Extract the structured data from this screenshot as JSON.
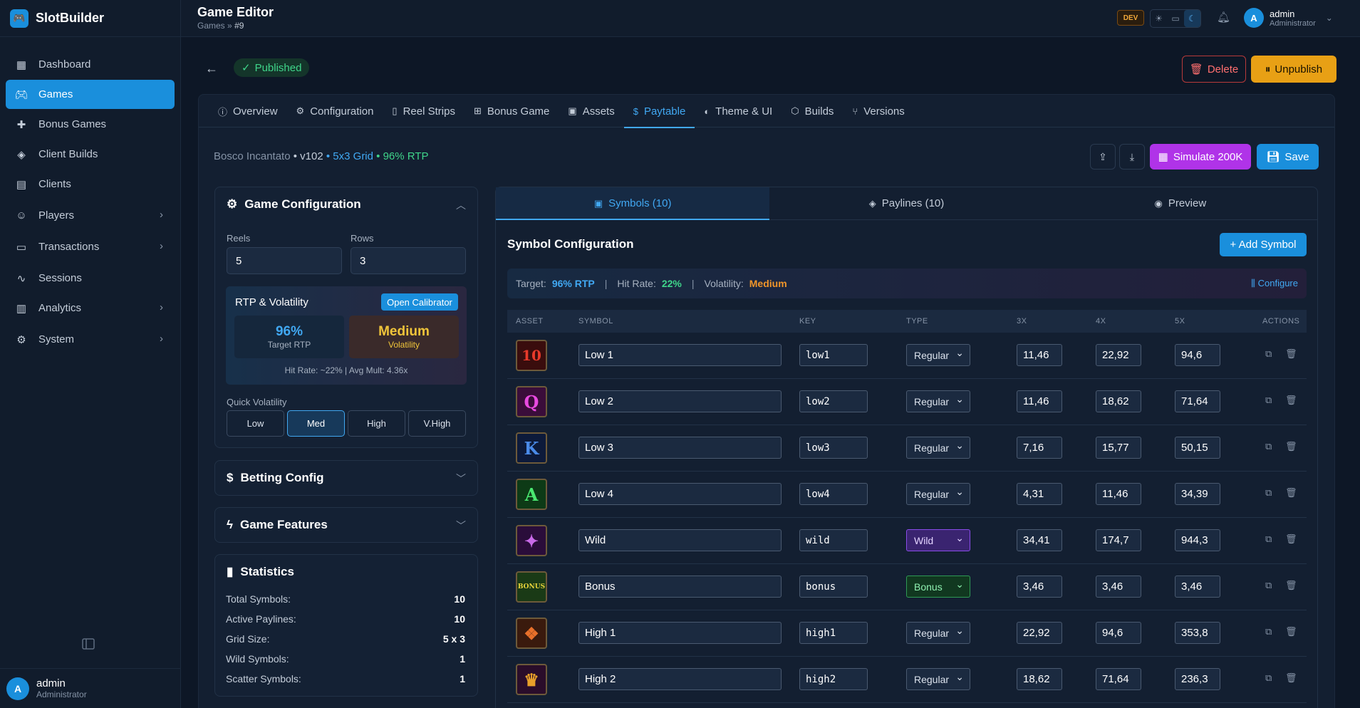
{
  "brand": {
    "name": "SlotBuilder"
  },
  "sidebar": {
    "items": [
      {
        "label": "Dashboard",
        "icon": "dashboard-icon",
        "active": false,
        "chevron": false
      },
      {
        "label": "Games",
        "icon": "gamepad-icon",
        "active": true,
        "chevron": false
      },
      {
        "label": "Bonus Games",
        "icon": "puzzle-icon",
        "active": false,
        "chevron": false
      },
      {
        "label": "Client Builds",
        "icon": "layers-icon",
        "active": false,
        "chevron": false
      },
      {
        "label": "Clients",
        "icon": "building-icon",
        "active": false,
        "chevron": false
      },
      {
        "label": "Players",
        "icon": "users-icon",
        "active": false,
        "chevron": true
      },
      {
        "label": "Transactions",
        "icon": "receipt-icon",
        "active": false,
        "chevron": true
      },
      {
        "label": "Sessions",
        "icon": "activity-icon",
        "active": false,
        "chevron": false
      },
      {
        "label": "Analytics",
        "icon": "bar-chart-icon",
        "active": false,
        "chevron": true
      },
      {
        "label": "System",
        "icon": "gear-icon",
        "active": false,
        "chevron": true
      }
    ],
    "user": {
      "initial": "A",
      "name": "admin",
      "role": "Administrator"
    }
  },
  "topbar": {
    "title": "Game Editor",
    "crumb_root": "Games",
    "crumb_sep": "»",
    "crumb_current": "#9",
    "env_badge": "DEV",
    "user": {
      "initial": "A",
      "name": "admin",
      "role": "Administrator"
    }
  },
  "status": {
    "label": "Published"
  },
  "actions": {
    "delete": "Delete",
    "unpublish": "Unpublish",
    "simulate": "Simulate 200K",
    "save": "Save"
  },
  "tabs": [
    {
      "label": "Overview",
      "icon": "info-icon"
    },
    {
      "label": "Configuration",
      "icon": "gear-icon"
    },
    {
      "label": "Reel Strips",
      "icon": "columns-icon"
    },
    {
      "label": "Bonus Game",
      "icon": "gift-icon"
    },
    {
      "label": "Assets",
      "icon": "image-icon"
    },
    {
      "label": "Paytable",
      "icon": "dollar-icon"
    },
    {
      "label": "Theme & UI",
      "icon": "palette-icon"
    },
    {
      "label": "Builds",
      "icon": "package-icon"
    },
    {
      "label": "Versions",
      "icon": "git-branch-icon"
    }
  ],
  "game": {
    "name": "Bosco Incantato",
    "version": "• v102",
    "grid": "• 5x3 Grid",
    "rtp": "• 96% RTP"
  },
  "config": {
    "title": "Game Configuration",
    "reels_label": "Reels",
    "reels": "5",
    "rows_label": "Rows",
    "rows": "3",
    "rtp_title": "RTP & Volatility",
    "calibrator": "Open Calibrator",
    "rtp_value": "96%",
    "rtp_label": "Target RTP",
    "vol_value": "Medium",
    "vol_label": "Volatility",
    "hit_summary": "Hit Rate: ~22% | Avg Mult: 4.36x",
    "quick_label": "Quick Volatility",
    "quick": [
      "Low",
      "Med",
      "High",
      "V.High"
    ]
  },
  "betting": {
    "title": "Betting Config"
  },
  "features": {
    "title": "Game Features"
  },
  "statistics": {
    "title": "Statistics",
    "rows": [
      {
        "label": "Total Symbols:",
        "value": "10"
      },
      {
        "label": "Active Paylines:",
        "value": "10"
      },
      {
        "label": "Grid Size:",
        "value": "5 x 3"
      },
      {
        "label": "Wild Symbols:",
        "value": "1"
      },
      {
        "label": "Scatter Symbols:",
        "value": "1"
      }
    ]
  },
  "subtabs": [
    "Symbols (10)",
    "Paylines (10)",
    "Preview"
  ],
  "symbols": {
    "title": "Symbol Configuration",
    "add": "+ Add Symbol",
    "target_label": "Target:",
    "target": "96% RTP",
    "hit_label": "Hit Rate:",
    "hit": "22%",
    "vol_label": "Volatility:",
    "vol": "Medium",
    "configure": "Configure",
    "headers": [
      "ASSET",
      "SYMBOL",
      "KEY",
      "TYPE",
      "3X",
      "4X",
      "5X",
      "ACTIONS"
    ],
    "rows": [
      {
        "glyph": "10",
        "color": "#e83a2a",
        "bg": "#3a0d0d",
        "name": "Low 1",
        "key": "low1",
        "type": "Regular",
        "x3": "11,46",
        "x4": "22,92",
        "x5": "94,6"
      },
      {
        "glyph": "Q",
        "color": "#e84ae0",
        "bg": "#3a0d3a",
        "name": "Low 2",
        "key": "low2",
        "type": "Regular",
        "x3": "11,46",
        "x4": "18,62",
        "x5": "71,64"
      },
      {
        "glyph": "K",
        "color": "#4a8ae8",
        "bg": "#0d1a3a",
        "name": "Low 3",
        "key": "low3",
        "type": "Regular",
        "x3": "7,16",
        "x4": "15,77",
        "x5": "50,15"
      },
      {
        "glyph": "A",
        "color": "#4ae870",
        "bg": "#0d3a16",
        "name": "Low 4",
        "key": "low4",
        "type": "Regular",
        "x3": "4,31",
        "x4": "11,46",
        "x5": "34,39"
      },
      {
        "glyph": "✦",
        "color": "#c86ae8",
        "bg": "#2a0d3a",
        "name": "Wild",
        "key": "wild",
        "type": "Wild",
        "x3": "34,41",
        "x4": "174,7",
        "x5": "944,3"
      },
      {
        "glyph": "BONUS",
        "color": "#e8d43a",
        "bg": "#1a3a16",
        "name": "Bonus",
        "key": "bonus",
        "type": "Bonus",
        "x3": "3,46",
        "x4": "3,46",
        "x5": "3,46"
      },
      {
        "glyph": "❖",
        "color": "#e8702a",
        "bg": "#3a1a0d",
        "name": "High 1",
        "key": "high1",
        "type": "Regular",
        "x3": "22,92",
        "x4": "94,6",
        "x5": "353,8"
      },
      {
        "glyph": "♛",
        "color": "#e8a02a",
        "bg": "#2a0d2a",
        "name": "High 2",
        "key": "high2",
        "type": "Regular",
        "x3": "18,62",
        "x4": "71,64",
        "x5": "236,3"
      }
    ]
  }
}
